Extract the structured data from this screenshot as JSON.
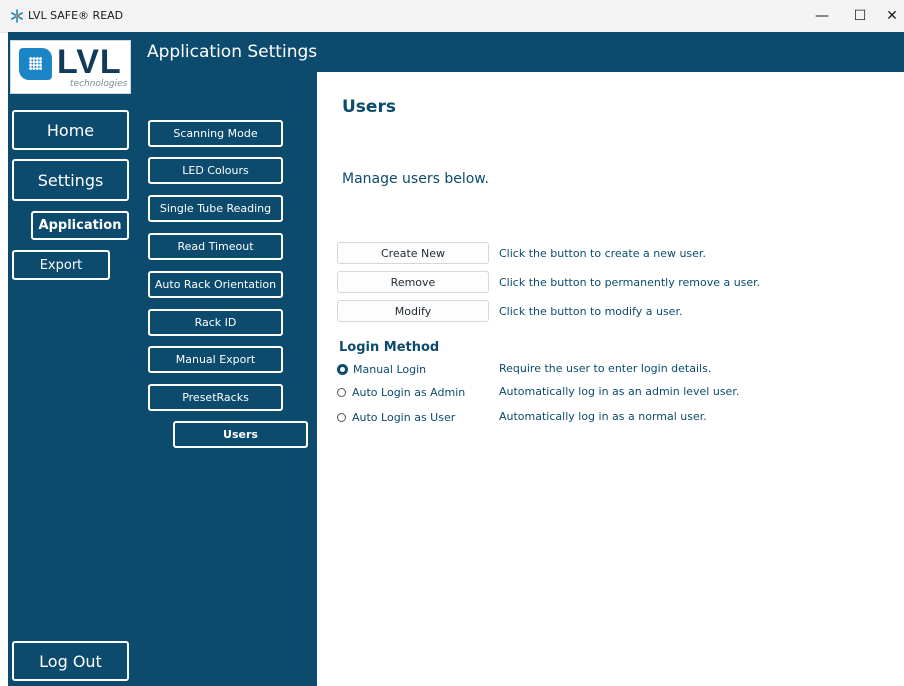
{
  "window": {
    "title": "LVL SAFE® READ",
    "minimize_glyph": "—",
    "maximize_glyph": "☐",
    "close_glyph": "✕"
  },
  "logo": {
    "text": "LVL",
    "subtitle": "technologies"
  },
  "header": {
    "title": "Application Settings"
  },
  "left_nav": {
    "home": "Home",
    "settings": "Settings",
    "application": "Application",
    "export": "Export",
    "logout": "Log Out"
  },
  "sub_nav": [
    {
      "label": "Scanning Mode",
      "active": false
    },
    {
      "label": "LED Colours",
      "active": false
    },
    {
      "label": "Single Tube Reading",
      "active": false
    },
    {
      "label": "Read Timeout",
      "active": false
    },
    {
      "label": "Auto Rack Orientation",
      "active": false
    },
    {
      "label": "Rack ID",
      "active": false
    },
    {
      "label": "Manual Export",
      "active": false
    },
    {
      "label": "PresetRacks",
      "active": false
    },
    {
      "label": "Users",
      "active": true
    }
  ],
  "content": {
    "title": "Users",
    "intro": "Manage users below.",
    "actions": [
      {
        "label": "Create New",
        "description": "Click the button to create a new user."
      },
      {
        "label": "Remove",
        "description": "Click the button to permanently remove a user."
      },
      {
        "label": "Modify",
        "description": "Click the button to modify a user."
      }
    ],
    "login_method": {
      "heading": "Login Method",
      "options": [
        {
          "label": "Manual Login",
          "description": "Require the user to enter login details.",
          "selected": true
        },
        {
          "label": "Auto Login as Admin",
          "description": "Automatically log in as an admin level user.",
          "selected": false
        },
        {
          "label": "Auto Login as User",
          "description": "Automatically log in as a normal user.",
          "selected": false
        }
      ]
    }
  },
  "colors": {
    "brand_navy": "#0c4b6e",
    "logo_blue": "#1b86c6",
    "white": "#ffffff"
  }
}
